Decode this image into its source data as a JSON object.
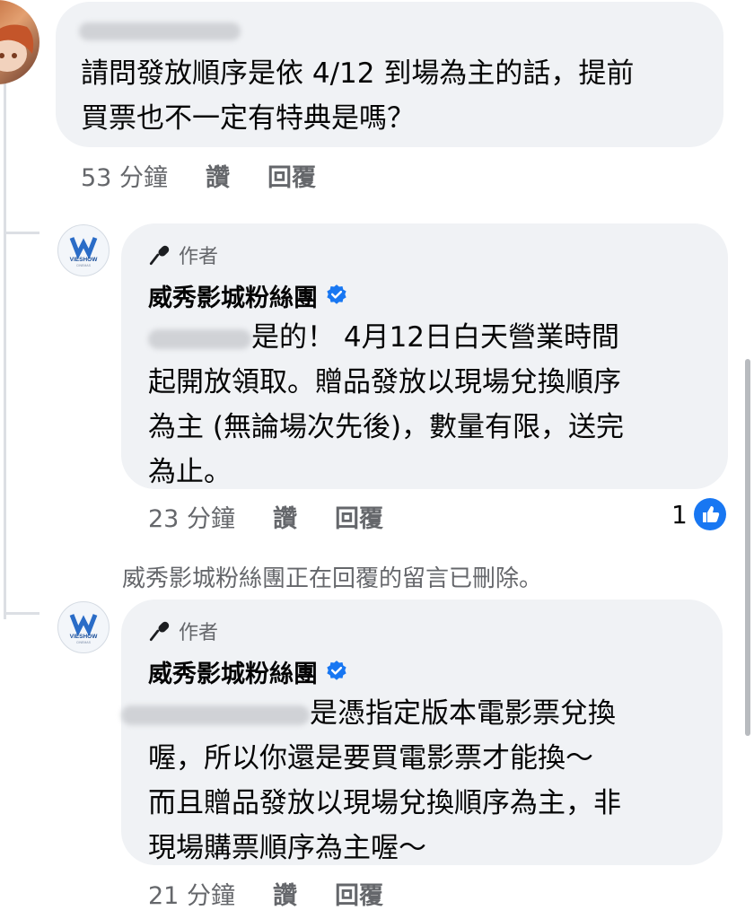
{
  "comment1": {
    "text_part1": "請問發放順序是依 4/12 到場為主的話，提前",
    "text_part2": "買票也不一定有特典是嗎？",
    "time": "53 分鐘",
    "like_label": "讚",
    "reply_label": "回覆"
  },
  "reply1": {
    "author_badge": "作者",
    "page_name": "威秀影城粉絲團",
    "line1": "是的！ 4月12日白天營業時間",
    "line2": "起開放領取。贈品發放以現場兌換順序",
    "line3": "為主 (無論場次先後)，數量有限，送完",
    "line4": "為止。",
    "time": "23 分鐘",
    "like_label": "讚",
    "reply_label": "回覆",
    "reaction_count": "1"
  },
  "deleted_notice": "威秀影城粉絲團正在回覆的留言已刪除。",
  "reply2": {
    "author_badge": "作者",
    "page_name": "威秀影城粉絲團",
    "line1": "是憑指定版本電影票兌換",
    "line2": "喔，所以你還是要買電影票才能換～",
    "line3": "而且贈品發放以現場兌換順序為主，非",
    "line4": "現場購票順序為主喔～",
    "time": "21 分鐘",
    "like_label": "讚",
    "reply_label": "回覆"
  },
  "logo": {
    "text": "VIESHOW",
    "subtext": "CINEMAS"
  },
  "colors": {
    "bubble": "#f0f2f5",
    "secondary_text": "#65676b",
    "verified_blue": "#1877f2",
    "like_blue": "#1877f2"
  }
}
